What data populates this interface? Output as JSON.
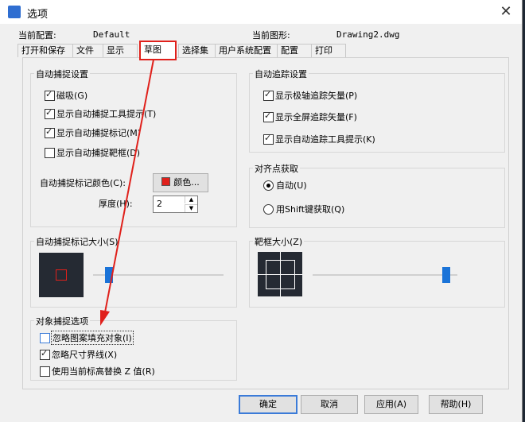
{
  "window": {
    "title": "选项"
  },
  "header": {
    "current_profile_label": "当前配置:",
    "current_profile_value": "Default",
    "current_drawing_label": "当前图形:",
    "current_drawing_value": "Drawing2.dwg"
  },
  "tabs": [
    "打开和保存",
    "文件",
    "显示",
    "草图",
    "选择集",
    "用户系统配置",
    "配置",
    "打印"
  ],
  "autosnap": {
    "title": "自动捕捉设置",
    "items": [
      "磁吸(G)",
      "显示自动捕捉工具提示(T)",
      "显示自动捕捉标记(M)",
      "显示自动捕捉靶框(D)"
    ],
    "checked": [
      true,
      true,
      true,
      false
    ],
    "color_label": "自动捕捉标记颜色(C):",
    "color_button": "颜色...",
    "marker_color": "#e0201b",
    "thickness_label": "厚度(H):",
    "thickness_value": "2"
  },
  "autotrack": {
    "title": "自动追踪设置",
    "items": [
      "显示极轴追踪矢量(P)",
      "显示全屏追踪矢量(F)",
      "显示自动追踪工具提示(K)"
    ],
    "checked": [
      true,
      true,
      true
    ]
  },
  "alignment": {
    "title": "对齐点获取",
    "options": [
      "自动(U)",
      "用Shift键获取(Q)"
    ],
    "selected": 0
  },
  "marker_size": {
    "title": "自动捕捉标记大小(S)",
    "level": 0.1
  },
  "aperture_size": {
    "title": "靶框大小(Z)",
    "level": 0.95
  },
  "object_snap": {
    "title": "对象捕捉选项",
    "items": [
      "忽略图案填充对象(I)",
      "忽略尺寸界线(X)",
      "使用当前标高替换 Z 值(R)"
    ],
    "checked": [
      false,
      true,
      false
    ]
  },
  "buttons": {
    "ok": "确定",
    "cancel": "取消",
    "apply": "应用(A)",
    "help": "帮助(H)"
  },
  "colors": {
    "accent": "#1a73d8",
    "highlight": "#e0201b"
  }
}
